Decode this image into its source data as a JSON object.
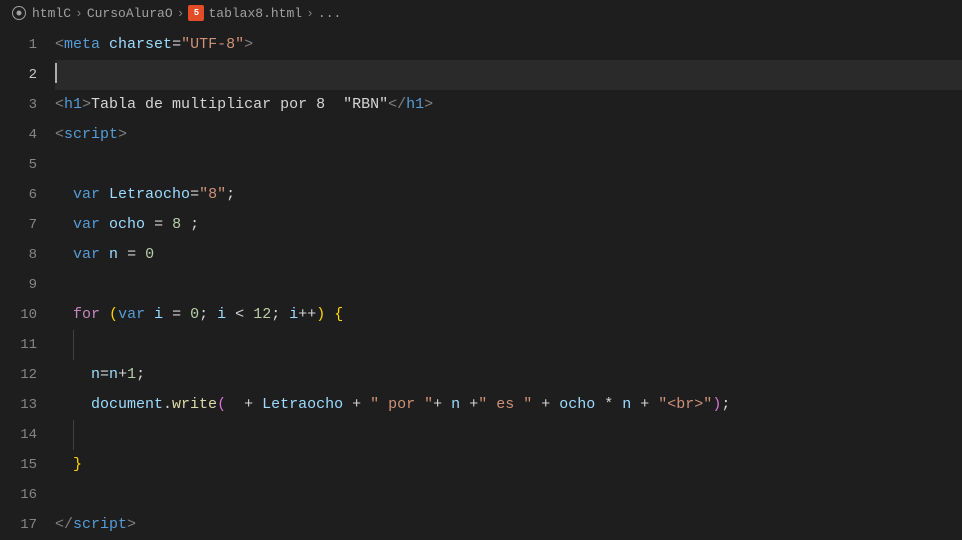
{
  "breadcrumb": {
    "item1": "htmlC",
    "item2": "CursoAluraO",
    "item3": "tablax8.html",
    "item4": "..."
  },
  "gutter": {
    "lines": [
      "1",
      "2",
      "3",
      "4",
      "5",
      "6",
      "7",
      "8",
      "9",
      "10",
      "11",
      "12",
      "13",
      "14",
      "15",
      "16",
      "17"
    ],
    "currentLine": 2
  },
  "code": {
    "l1": {
      "open": "<",
      "tag": "meta",
      "sp": " ",
      "attr": "charset",
      "eq": "=",
      "val": "\"UTF-8\"",
      "close": ">"
    },
    "l3": {
      "open1": "<",
      "tag1": "h1",
      "close1": ">",
      "text": "Tabla de multiplicar por 8  \"RBN\"",
      "open2": "</",
      "tag2": "h1",
      "close2": ">"
    },
    "l4": {
      "open": "<",
      "tag": "script",
      "close": ">"
    },
    "l6": {
      "kw": "var",
      "sp": " ",
      "name": "Letraocho",
      "eq": "=",
      "val": "\"8\"",
      "semi": ";"
    },
    "l7": {
      "kw": "var",
      "sp": " ",
      "name": "ocho",
      "eq": " = ",
      "val": "8",
      "semi": " ;"
    },
    "l8": {
      "kw": "var",
      "sp": " ",
      "name": "n",
      "eq": " = ",
      "val": "0"
    },
    "l10": {
      "for": "for",
      "sp": " ",
      "lp": "(",
      "kw": "var",
      "sp2": " ",
      "i": "i",
      "eq": " = ",
      "zero": "0",
      "semi1": "; ",
      "i2": "i",
      "lt": " < ",
      "twelve": "12",
      "semi2": "; ",
      "i3": "i",
      "inc": "++",
      "rp": ")",
      "sp3": " ",
      "lb": "{"
    },
    "l12": {
      "n1": "n",
      "eq": "=",
      "n2": "n",
      "plus": "+",
      "one": "1",
      "semi": ";"
    },
    "l13": {
      "obj": "document",
      "dot": ".",
      "fn": "write",
      "lp": "(",
      "sp1": "  ",
      "plus1": "+ ",
      "v1": "Letraocho",
      "plus2": " + ",
      "s1": "\" por \"",
      "plus3": "+ ",
      "v2": "n",
      "plus4": " +",
      "s2": "\" es \"",
      "plus5": " + ",
      "v3": "ocho",
      "mul": " * ",
      "v4": "n",
      "plus6": " + ",
      "s3": "\"<br>\"",
      "rp": ")",
      "semi": ";"
    },
    "l15": {
      "rb": "}"
    },
    "l17": {
      "open": "</",
      "tag": "script",
      "close": ">"
    }
  }
}
